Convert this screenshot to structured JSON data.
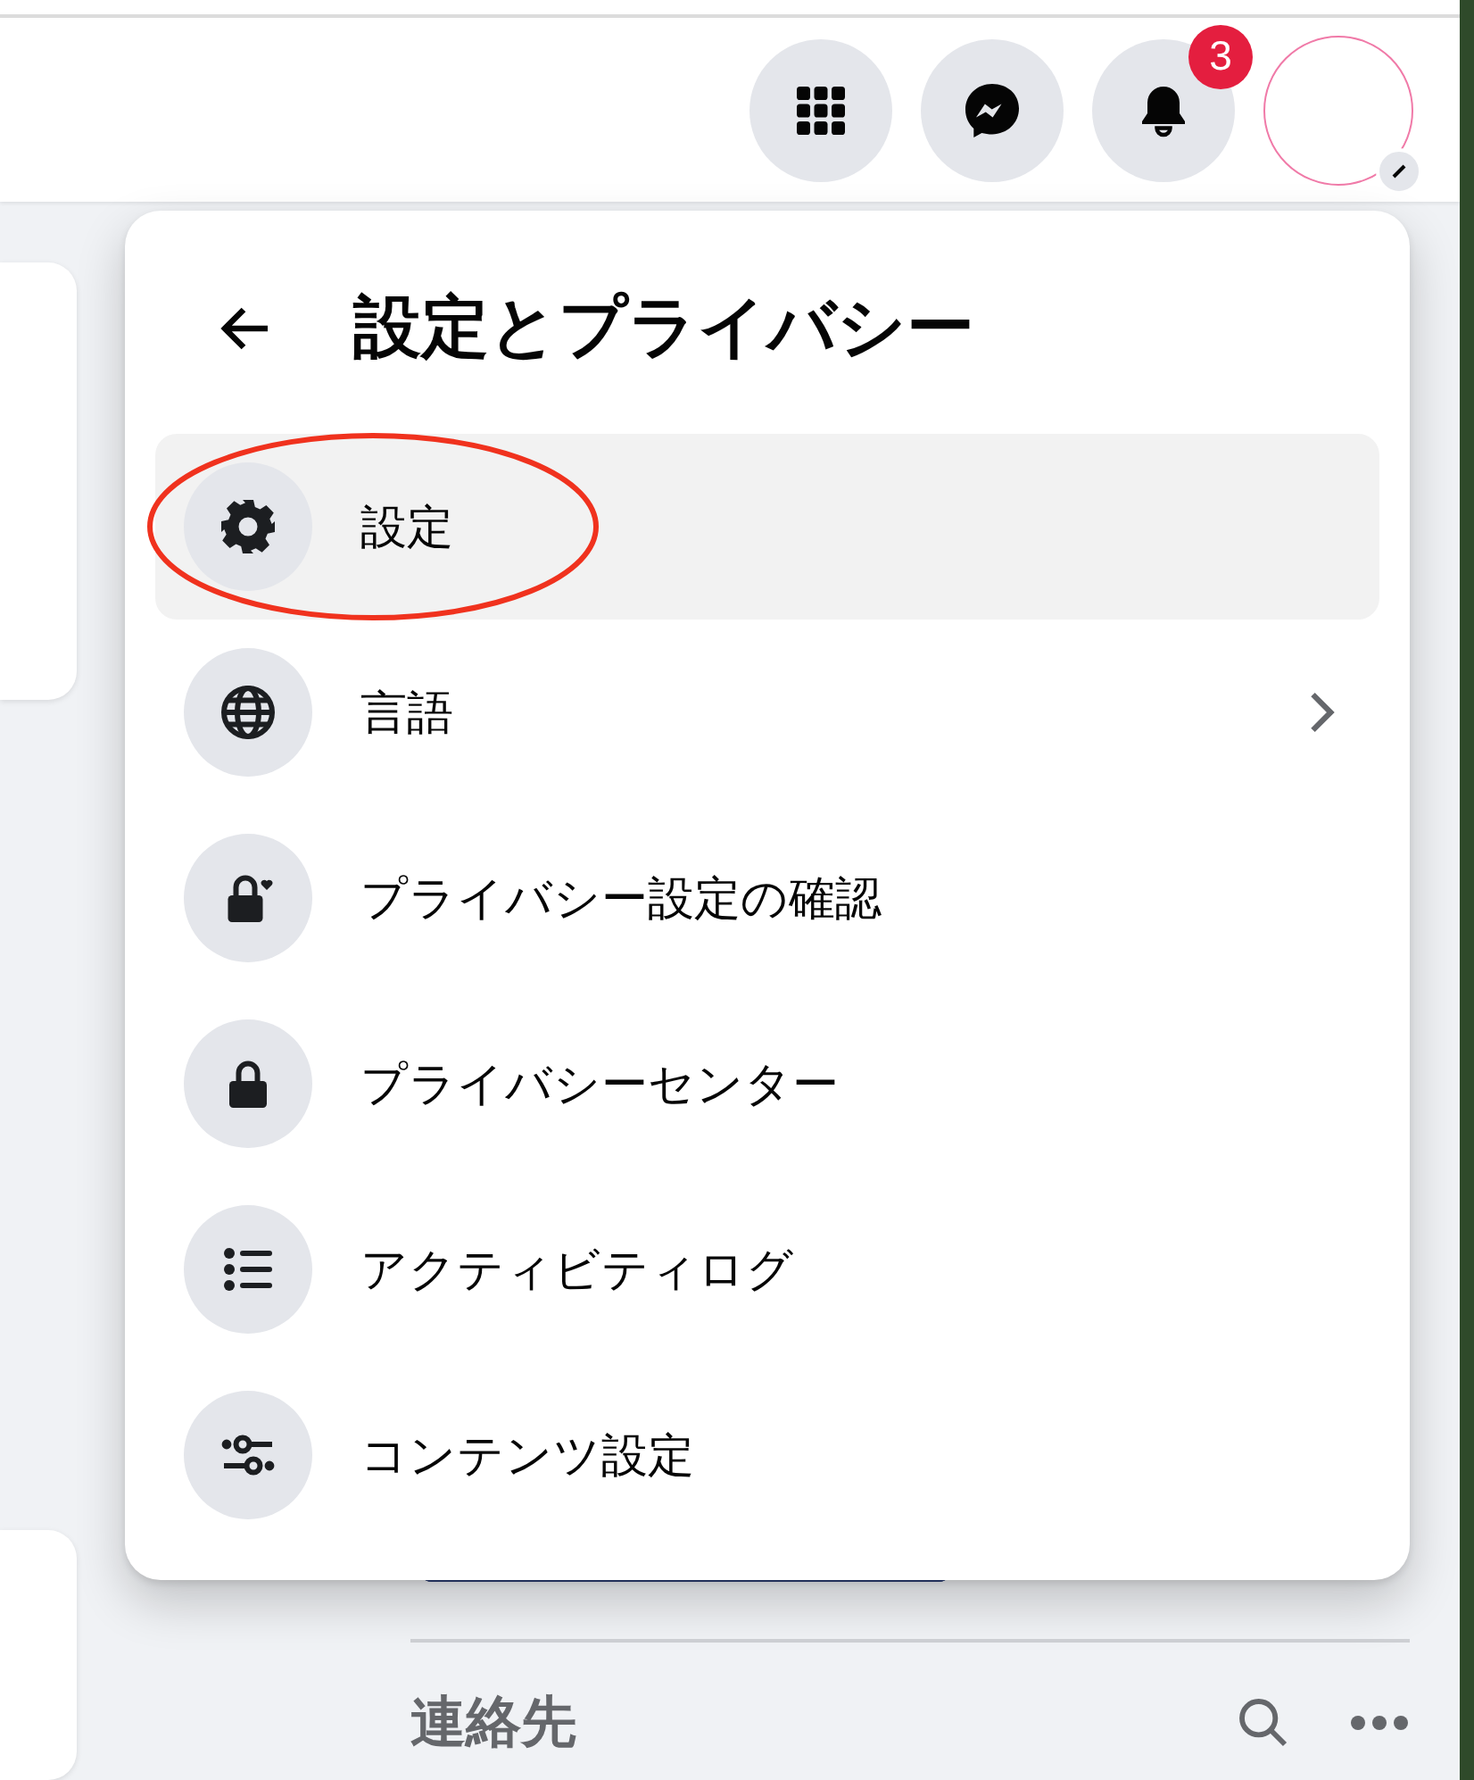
{
  "header": {
    "notification_badge": "3"
  },
  "menu": {
    "title": "設定とプライバシー",
    "items": [
      {
        "kind": "gear",
        "label": "設定",
        "selected": true,
        "circled": true,
        "submenu": false
      },
      {
        "kind": "globe",
        "label": "言語",
        "selected": false,
        "circled": false,
        "submenu": true
      },
      {
        "kind": "lock-heart",
        "label": "プライバシー設定の確認",
        "selected": false,
        "circled": false,
        "submenu": false
      },
      {
        "kind": "lock",
        "label": "プライバシーセンター",
        "selected": false,
        "circled": false,
        "submenu": false
      },
      {
        "kind": "list",
        "label": "アクティビティログ",
        "selected": false,
        "circled": false,
        "submenu": false
      },
      {
        "kind": "sliders",
        "label": "コンテンツ設定",
        "selected": false,
        "circled": false,
        "submenu": false
      }
    ]
  },
  "contacts": {
    "title": "連絡先"
  }
}
